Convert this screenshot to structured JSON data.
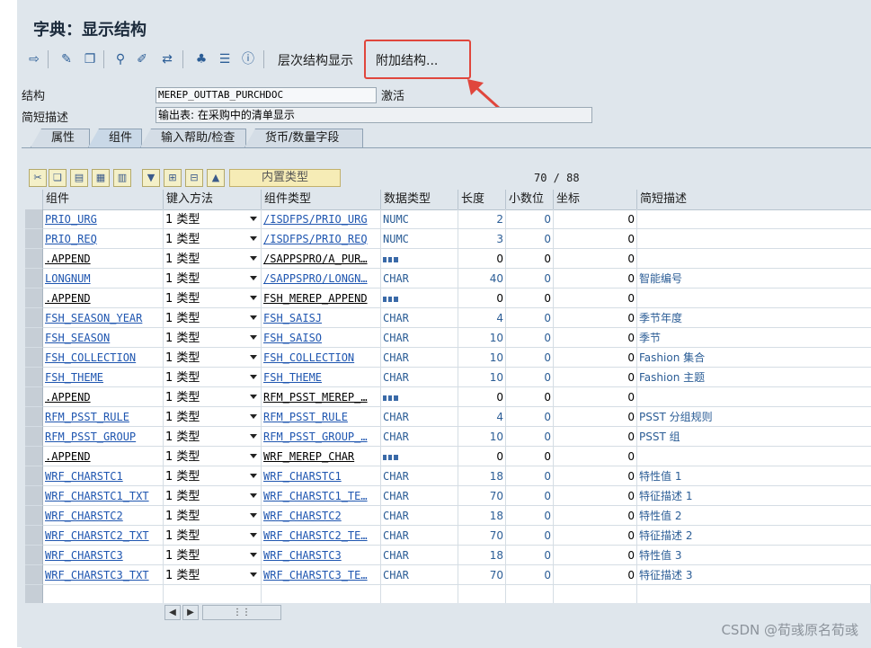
{
  "window": {
    "title": "字典：显示结构"
  },
  "toolbar": {
    "hierarchy_label": "层次结构显示",
    "append_label": "附加结构..."
  },
  "header": {
    "structure_label": "结构",
    "structure_value": "MEREP_OUTTAB_PURCHDOC",
    "status": "激活",
    "desc_label": "简短描述",
    "desc_value": "输出表: 在采购中的清单显示"
  },
  "tabs": [
    {
      "label": "属性"
    },
    {
      "label": "组件"
    },
    {
      "label": "输入帮助/检查"
    },
    {
      "label": "货币/数量字段"
    }
  ],
  "grid_toolbar": {
    "builtin_type": "内置类型",
    "position": "70",
    "total": "88"
  },
  "columns": [
    "组件",
    "键入方法",
    "组件类型",
    "数据类型",
    "长度",
    "小数位",
    "坐标",
    "简短描述"
  ],
  "rows": [
    {
      "comp": "PRIO_URG",
      "method": "1 类型",
      "ctype": "/ISDFPS/PRIO_URG",
      "dtype": "NUMC",
      "len": "2",
      "dec": "0",
      "coord": "0",
      "desc": "",
      "link": true
    },
    {
      "comp": "PRIO_REQ",
      "method": "1 类型",
      "ctype": "/ISDFPS/PRIO_REQ",
      "dtype": "NUMC",
      "len": "3",
      "dec": "0",
      "coord": "0",
      "desc": "",
      "link": true
    },
    {
      "comp": ".APPEND",
      "method": "1 类型",
      "ctype": "/SAPPSPRO/A_PUR…",
      "dtype": "",
      "len": "0",
      "dec": "0",
      "coord": "0",
      "desc": "",
      "link": false
    },
    {
      "comp": "LONGNUM",
      "method": "1 类型",
      "ctype": "/SAPPSPRO/LONGN…",
      "dtype": "CHAR",
      "len": "40",
      "dec": "0",
      "coord": "0",
      "desc": "智能编号",
      "link": true
    },
    {
      "comp": ".APPEND",
      "method": "1 类型",
      "ctype": "FSH_MEREP_APPEND",
      "dtype": "",
      "len": "0",
      "dec": "0",
      "coord": "0",
      "desc": "",
      "link": false
    },
    {
      "comp": "FSH_SEASON_YEAR",
      "method": "1 类型",
      "ctype": "FSH_SAISJ",
      "dtype": "CHAR",
      "len": "4",
      "dec": "0",
      "coord": "0",
      "desc": "季节年度",
      "link": true
    },
    {
      "comp": "FSH_SEASON",
      "method": "1 类型",
      "ctype": "FSH_SAISO",
      "dtype": "CHAR",
      "len": "10",
      "dec": "0",
      "coord": "0",
      "desc": "季节",
      "link": true
    },
    {
      "comp": "FSH_COLLECTION",
      "method": "1 类型",
      "ctype": "FSH_COLLECTION",
      "dtype": "CHAR",
      "len": "10",
      "dec": "0",
      "coord": "0",
      "desc": "Fashion 集合",
      "link": true
    },
    {
      "comp": "FSH_THEME",
      "method": "1 类型",
      "ctype": "FSH_THEME",
      "dtype": "CHAR",
      "len": "10",
      "dec": "0",
      "coord": "0",
      "desc": "Fashion 主题",
      "link": true
    },
    {
      "comp": ".APPEND",
      "method": "1 类型",
      "ctype": "RFM_PSST_MEREP_…",
      "dtype": "",
      "len": "0",
      "dec": "0",
      "coord": "0",
      "desc": "",
      "link": false
    },
    {
      "comp": "RFM_PSST_RULE",
      "method": "1 类型",
      "ctype": "RFM_PSST_RULE",
      "dtype": "CHAR",
      "len": "4",
      "dec": "0",
      "coord": "0",
      "desc": "PSST 分组规则",
      "link": true
    },
    {
      "comp": "RFM_PSST_GROUP",
      "method": "1 类型",
      "ctype": "RFM_PSST_GROUP_…",
      "dtype": "CHAR",
      "len": "10",
      "dec": "0",
      "coord": "0",
      "desc": "PSST 组",
      "link": true
    },
    {
      "comp": ".APPEND",
      "method": "1 类型",
      "ctype": "WRF_MEREP_CHAR",
      "dtype": "",
      "len": "0",
      "dec": "0",
      "coord": "0",
      "desc": "",
      "link": false
    },
    {
      "comp": "WRF_CHARSTC1",
      "method": "1 类型",
      "ctype": "WRF_CHARSTC1",
      "dtype": "CHAR",
      "len": "18",
      "dec": "0",
      "coord": "0",
      "desc": "特性值 1",
      "link": true
    },
    {
      "comp": "WRF_CHARSTC1_TXT",
      "method": "1 类型",
      "ctype": "WRF_CHARSTC1_TE…",
      "dtype": "CHAR",
      "len": "70",
      "dec": "0",
      "coord": "0",
      "desc": "特征描述 1",
      "link": true
    },
    {
      "comp": "WRF_CHARSTC2",
      "method": "1 类型",
      "ctype": "WRF_CHARSTC2",
      "dtype": "CHAR",
      "len": "18",
      "dec": "0",
      "coord": "0",
      "desc": "特性值 2",
      "link": true
    },
    {
      "comp": "WRF_CHARSTC2_TXT",
      "method": "1 类型",
      "ctype": "WRF_CHARSTC2_TE…",
      "dtype": "CHAR",
      "len": "70",
      "dec": "0",
      "coord": "0",
      "desc": "特征描述 2",
      "link": true
    },
    {
      "comp": "WRF_CHARSTC3",
      "method": "1 类型",
      "ctype": "WRF_CHARSTC3",
      "dtype": "CHAR",
      "len": "18",
      "dec": "0",
      "coord": "0",
      "desc": "特性值 3",
      "link": true
    },
    {
      "comp": "WRF_CHARSTC3_TXT",
      "method": "1 类型",
      "ctype": "WRF_CHARSTC3_TE…",
      "dtype": "CHAR",
      "len": "70",
      "dec": "0",
      "coord": "0",
      "desc": "特征描述 3",
      "link": true
    }
  ],
  "watermark": "CSDN @荀彧原名荀彧"
}
